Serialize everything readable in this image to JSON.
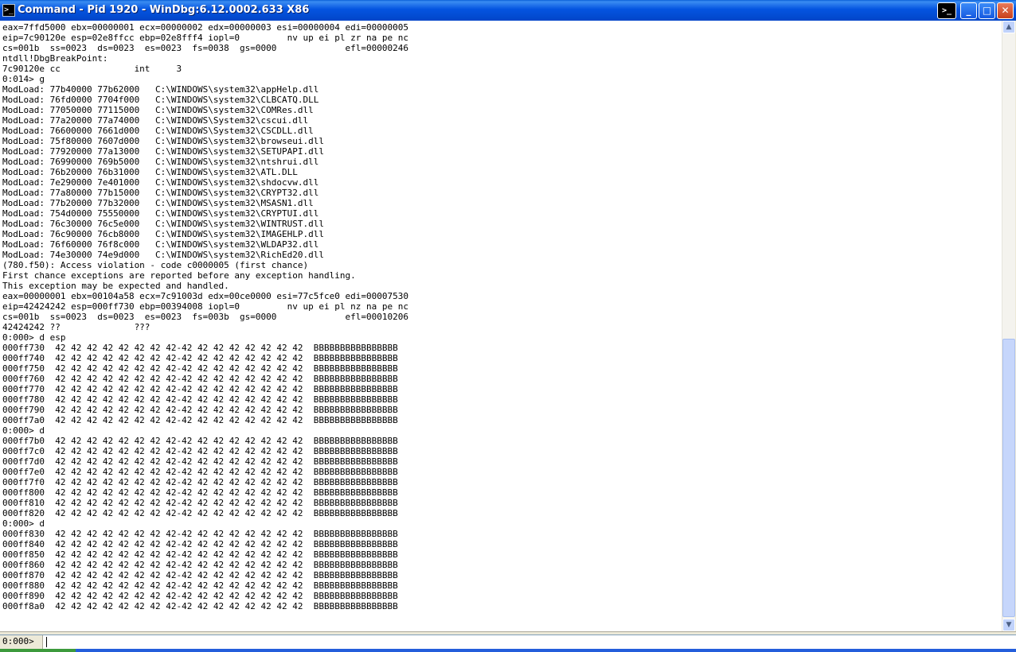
{
  "window": {
    "title": "Command - Pid 1920 - WinDbg:6.12.0002.633 X86",
    "icon_glyph": ">_",
    "controls": {
      "command_glyph": ">_",
      "minimize": "_",
      "maximize": "□",
      "close": "✕"
    }
  },
  "output": {
    "lines": [
      "eax=7ffd5000 ebx=00000001 ecx=00000002 edx=00000003 esi=00000004 edi=00000005",
      "eip=7c90120e esp=02e8ffcc ebp=02e8fff4 iopl=0         nv up ei pl zr na pe nc",
      "cs=001b  ss=0023  ds=0023  es=0023  fs=0038  gs=0000             efl=00000246",
      "ntdll!DbgBreakPoint:",
      "7c90120e cc              int     3",
      "0:014> g",
      "ModLoad: 77b40000 77b62000   C:\\WINDOWS\\system32\\appHelp.dll",
      "ModLoad: 76fd0000 7704f000   C:\\WINDOWS\\system32\\CLBCATQ.DLL",
      "ModLoad: 77050000 77115000   C:\\WINDOWS\\system32\\COMRes.dll",
      "ModLoad: 77a20000 77a74000   C:\\WINDOWS\\System32\\cscui.dll",
      "ModLoad: 76600000 7661d000   C:\\WINDOWS\\System32\\CSCDLL.dll",
      "ModLoad: 75f80000 7607d000   C:\\WINDOWS\\system32\\browseui.dll",
      "ModLoad: 77920000 77a13000   C:\\WINDOWS\\system32\\SETUPAPI.dll",
      "ModLoad: 76990000 769b5000   C:\\WINDOWS\\system32\\ntshrui.dll",
      "ModLoad: 76b20000 76b31000   C:\\WINDOWS\\system32\\ATL.DLL",
      "ModLoad: 7e290000 7e401000   C:\\WINDOWS\\system32\\shdocvw.dll",
      "ModLoad: 77a80000 77b15000   C:\\WINDOWS\\system32\\CRYPT32.dll",
      "ModLoad: 77b20000 77b32000   C:\\WINDOWS\\system32\\MSASN1.dll",
      "ModLoad: 754d0000 75550000   C:\\WINDOWS\\system32\\CRYPTUI.dll",
      "ModLoad: 76c30000 76c5e000   C:\\WINDOWS\\system32\\WINTRUST.dll",
      "ModLoad: 76c90000 76cb8000   C:\\WINDOWS\\system32\\IMAGEHLP.dll",
      "ModLoad: 76f60000 76f8c000   C:\\WINDOWS\\system32\\WLDAP32.dll",
      "ModLoad: 74e30000 74e9d000   C:\\WINDOWS\\system32\\RichEd20.dll",
      "(780.f50): Access violation - code c0000005 (first chance)",
      "First chance exceptions are reported before any exception handling.",
      "This exception may be expected and handled.",
      "eax=00000001 ebx=00104a58 ecx=7c91003d edx=00ce0000 esi=77c5fce0 edi=00007530",
      "eip=42424242 esp=000ff730 ebp=00394008 iopl=0         nv up ei pl nz na pe nc",
      "cs=001b  ss=0023  ds=0023  es=0023  fs=003b  gs=0000             efl=00010206",
      "42424242 ??              ???",
      "0:000> d esp",
      "000ff730  42 42 42 42 42 42 42 42-42 42 42 42 42 42 42 42  BBBBBBBBBBBBBBBB",
      "000ff740  42 42 42 42 42 42 42 42-42 42 42 42 42 42 42 42  BBBBBBBBBBBBBBBB",
      "000ff750  42 42 42 42 42 42 42 42-42 42 42 42 42 42 42 42  BBBBBBBBBBBBBBBB",
      "000ff760  42 42 42 42 42 42 42 42-42 42 42 42 42 42 42 42  BBBBBBBBBBBBBBBB",
      "000ff770  42 42 42 42 42 42 42 42-42 42 42 42 42 42 42 42  BBBBBBBBBBBBBBBB",
      "000ff780  42 42 42 42 42 42 42 42-42 42 42 42 42 42 42 42  BBBBBBBBBBBBBBBB",
      "000ff790  42 42 42 42 42 42 42 42-42 42 42 42 42 42 42 42  BBBBBBBBBBBBBBBB",
      "000ff7a0  42 42 42 42 42 42 42 42-42 42 42 42 42 42 42 42  BBBBBBBBBBBBBBBB",
      "0:000> d",
      "000ff7b0  42 42 42 42 42 42 42 42-42 42 42 42 42 42 42 42  BBBBBBBBBBBBBBBB",
      "000ff7c0  42 42 42 42 42 42 42 42-42 42 42 42 42 42 42 42  BBBBBBBBBBBBBBBB",
      "000ff7d0  42 42 42 42 42 42 42 42-42 42 42 42 42 42 42 42  BBBBBBBBBBBBBBBB",
      "000ff7e0  42 42 42 42 42 42 42 42-42 42 42 42 42 42 42 42  BBBBBBBBBBBBBBBB",
      "000ff7f0  42 42 42 42 42 42 42 42-42 42 42 42 42 42 42 42  BBBBBBBBBBBBBBBB",
      "000ff800  42 42 42 42 42 42 42 42-42 42 42 42 42 42 42 42  BBBBBBBBBBBBBBBB",
      "000ff810  42 42 42 42 42 42 42 42-42 42 42 42 42 42 42 42  BBBBBBBBBBBBBBBB",
      "000ff820  42 42 42 42 42 42 42 42-42 42 42 42 42 42 42 42  BBBBBBBBBBBBBBBB",
      "0:000> d",
      "000ff830  42 42 42 42 42 42 42 42-42 42 42 42 42 42 42 42  BBBBBBBBBBBBBBBB",
      "000ff840  42 42 42 42 42 42 42 42-42 42 42 42 42 42 42 42  BBBBBBBBBBBBBBBB",
      "000ff850  42 42 42 42 42 42 42 42-42 42 42 42 42 42 42 42  BBBBBBBBBBBBBBBB",
      "000ff860  42 42 42 42 42 42 42 42-42 42 42 42 42 42 42 42  BBBBBBBBBBBBBBBB",
      "000ff870  42 42 42 42 42 42 42 42-42 42 42 42 42 42 42 42  BBBBBBBBBBBBBBBB",
      "000ff880  42 42 42 42 42 42 42 42-42 42 42 42 42 42 42 42  BBBBBBBBBBBBBBBB",
      "000ff890  42 42 42 42 42 42 42 42-42 42 42 42 42 42 42 42  BBBBBBBBBBBBBBBB",
      "000ff8a0  42 42 42 42 42 42 42 42-42 42 42 42 42 42 42 42  BBBBBBBBBBBBBBBB"
    ]
  },
  "scrollbar": {
    "up_glyph": "▲",
    "down_glyph": "▼"
  },
  "command_bar": {
    "prompt": "0:000>",
    "value": ""
  },
  "colors": {
    "titlebar": "#0454e0",
    "output_bg": "#ffffff",
    "text": "#000000",
    "chrome": "#ece9d8"
  }
}
